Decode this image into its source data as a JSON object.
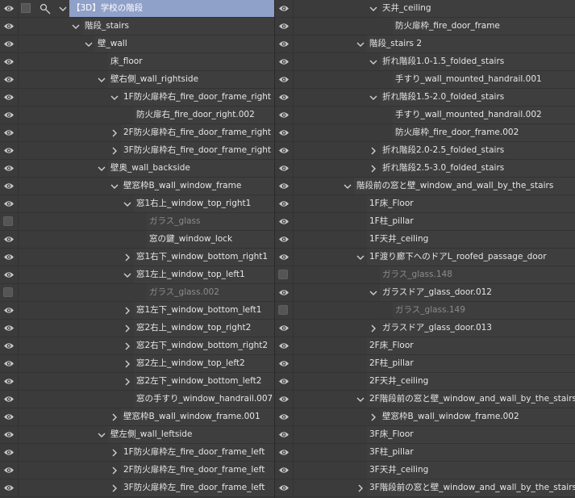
{
  "left_rows": [
    {
      "label": "【3D】学校の階段",
      "indent": 0,
      "chev": "down",
      "visible": true,
      "selected": true,
      "dim": false
    },
    {
      "label": "階段_stairs",
      "indent": 1,
      "chev": "down",
      "visible": true,
      "selected": false,
      "dim": false
    },
    {
      "label": "壁_wall",
      "indent": 2,
      "chev": "down",
      "visible": true,
      "selected": false,
      "dim": false
    },
    {
      "label": "床_floor",
      "indent": 3,
      "chev": "",
      "visible": true,
      "selected": false,
      "dim": false
    },
    {
      "label": "壁右側_wall_rightside",
      "indent": 3,
      "chev": "down",
      "visible": true,
      "selected": false,
      "dim": false
    },
    {
      "label": "1F防火扉枠右_fire_door_frame_right",
      "indent": 4,
      "chev": "down",
      "visible": true,
      "selected": false,
      "dim": false
    },
    {
      "label": "防火扉右_fire_door_right.002",
      "indent": 5,
      "chev": "",
      "visible": true,
      "selected": false,
      "dim": false
    },
    {
      "label": "2F防火扉枠右_fire_door_frame_right",
      "indent": 4,
      "chev": "right",
      "visible": true,
      "selected": false,
      "dim": false
    },
    {
      "label": "3F防火扉枠右_fire_door_frame_right",
      "indent": 4,
      "chev": "right",
      "visible": true,
      "selected": false,
      "dim": false
    },
    {
      "label": "壁奥_wall_backside",
      "indent": 3,
      "chev": "down",
      "visible": true,
      "selected": false,
      "dim": false
    },
    {
      "label": "壁窓枠B_wall_window_frame",
      "indent": 4,
      "chev": "down",
      "visible": true,
      "selected": false,
      "dim": false
    },
    {
      "label": "窓1右上_window_top_right1",
      "indent": 5,
      "chev": "down",
      "visible": true,
      "selected": false,
      "dim": false
    },
    {
      "label": "ガラス_glass",
      "indent": 6,
      "chev": "",
      "visible": false,
      "selected": false,
      "dim": true
    },
    {
      "label": "窓の鍵_window_lock",
      "indent": 6,
      "chev": "",
      "visible": true,
      "selected": false,
      "dim": false
    },
    {
      "label": "窓1右下_window_bottom_right1",
      "indent": 5,
      "chev": "right",
      "visible": true,
      "selected": false,
      "dim": false
    },
    {
      "label": "窓1左上_window_top_left1",
      "indent": 5,
      "chev": "down",
      "visible": true,
      "selected": false,
      "dim": false
    },
    {
      "label": "ガラス_glass.002",
      "indent": 6,
      "chev": "",
      "visible": false,
      "selected": false,
      "dim": true
    },
    {
      "label": "窓1左下_window_bottom_left1",
      "indent": 5,
      "chev": "right",
      "visible": true,
      "selected": false,
      "dim": false
    },
    {
      "label": "窓2右上_window_top_right2",
      "indent": 5,
      "chev": "right",
      "visible": true,
      "selected": false,
      "dim": false
    },
    {
      "label": "窓2右下_window_bottom_right2",
      "indent": 5,
      "chev": "right",
      "visible": true,
      "selected": false,
      "dim": false
    },
    {
      "label": "窓2左上_window_top_left2",
      "indent": 5,
      "chev": "right",
      "visible": true,
      "selected": false,
      "dim": false
    },
    {
      "label": "窓2左下_window_bottom_left2",
      "indent": 5,
      "chev": "right",
      "visible": true,
      "selected": false,
      "dim": false
    },
    {
      "label": "窓の手すり_window_handrail.007",
      "indent": 5,
      "chev": "",
      "visible": true,
      "selected": false,
      "dim": false
    },
    {
      "label": "壁窓枠B_wall_window_frame.001",
      "indent": 4,
      "chev": "right",
      "visible": true,
      "selected": false,
      "dim": false
    },
    {
      "label": "壁左側_wall_leftside",
      "indent": 3,
      "chev": "down",
      "visible": true,
      "selected": false,
      "dim": false
    },
    {
      "label": "1F防火扉枠左_fire_door_frame_left",
      "indent": 4,
      "chev": "right",
      "visible": true,
      "selected": false,
      "dim": false
    },
    {
      "label": "2F防火扉枠左_fire_door_frame_left",
      "indent": 4,
      "chev": "right",
      "visible": true,
      "selected": false,
      "dim": false
    },
    {
      "label": "3F防火扉枠左_fire_door_frame_left",
      "indent": 4,
      "chev": "right",
      "visible": true,
      "selected": false,
      "dim": false
    }
  ],
  "right_rows": [
    {
      "label": "天井_ceiling",
      "indent": 2,
      "chev": "down",
      "visible": true,
      "dim": false
    },
    {
      "label": "防火扉枠_fire_door_frame",
      "indent": 3,
      "chev": "",
      "visible": true,
      "dim": false
    },
    {
      "label": "階段_stairs 2",
      "indent": 1,
      "chev": "down",
      "visible": true,
      "dim": false
    },
    {
      "label": "折れ階段1.0-1.5_folded_stairs",
      "indent": 2,
      "chev": "down",
      "visible": true,
      "dim": false
    },
    {
      "label": "手すり_wall_mounted_handrail.001",
      "indent": 3,
      "chev": "",
      "visible": true,
      "dim": false
    },
    {
      "label": "折れ階段1.5-2.0_folded_stairs",
      "indent": 2,
      "chev": "down",
      "visible": true,
      "dim": false
    },
    {
      "label": "手すり_wall_mounted_handrail.002",
      "indent": 3,
      "chev": "",
      "visible": true,
      "dim": false
    },
    {
      "label": "防火扉枠_fire_door_frame.002",
      "indent": 3,
      "chev": "",
      "visible": true,
      "dim": false
    },
    {
      "label": "折れ階段2.0-2.5_folded_stairs",
      "indent": 2,
      "chev": "right",
      "visible": true,
      "dim": false
    },
    {
      "label": "折れ階段2.5-3.0_folded_stairs",
      "indent": 2,
      "chev": "right",
      "visible": true,
      "dim": false
    },
    {
      "label": "階段前の窓と壁_window_and_wall_by_the_stairs",
      "indent": 0,
      "chev": "down",
      "visible": true,
      "dim": false
    },
    {
      "label": "1F床_Floor",
      "indent": 1,
      "chev": "",
      "visible": true,
      "dim": false
    },
    {
      "label": "1F柱_pillar",
      "indent": 1,
      "chev": "",
      "visible": true,
      "dim": false
    },
    {
      "label": "1F天井_ceiling",
      "indent": 1,
      "chev": "",
      "visible": true,
      "dim": false
    },
    {
      "label": "1F渡り廊下へのドアL_roofed_passage_door",
      "indent": 1,
      "chev": "down",
      "visible": true,
      "dim": false
    },
    {
      "label": "ガラス_glass.148",
      "indent": 2,
      "chev": "",
      "visible": false,
      "dim": true
    },
    {
      "label": "ガラスドア_glass_door.012",
      "indent": 2,
      "chev": "down",
      "visible": true,
      "dim": false
    },
    {
      "label": "ガラス_glass.149",
      "indent": 3,
      "chev": "",
      "visible": false,
      "dim": true
    },
    {
      "label": "ガラスドア_glass_door.013",
      "indent": 2,
      "chev": "right",
      "visible": true,
      "dim": false
    },
    {
      "label": "2F床_Floor",
      "indent": 1,
      "chev": "",
      "visible": true,
      "dim": false
    },
    {
      "label": "2F柱_pillar",
      "indent": 1,
      "chev": "",
      "visible": true,
      "dim": false
    },
    {
      "label": "2F天井_ceiling",
      "indent": 1,
      "chev": "",
      "visible": true,
      "dim": false
    },
    {
      "label": "2F階段前の窓と壁_window_and_wall_by_the_stairs",
      "indent": 1,
      "chev": "down",
      "visible": true,
      "dim": false
    },
    {
      "label": "壁窓枠B_wall_window_frame.002",
      "indent": 2,
      "chev": "right",
      "visible": true,
      "dim": false
    },
    {
      "label": "3F床_Floor",
      "indent": 1,
      "chev": "",
      "visible": true,
      "dim": false
    },
    {
      "label": "3F柱_pillar",
      "indent": 1,
      "chev": "",
      "visible": true,
      "dim": false
    },
    {
      "label": "3F天井_ceiling",
      "indent": 1,
      "chev": "",
      "visible": true,
      "dim": false
    },
    {
      "label": "3F階段前の窓と壁_window_and_wall_by_the_stairs",
      "indent": 1,
      "chev": "right",
      "visible": true,
      "dim": false
    }
  ]
}
